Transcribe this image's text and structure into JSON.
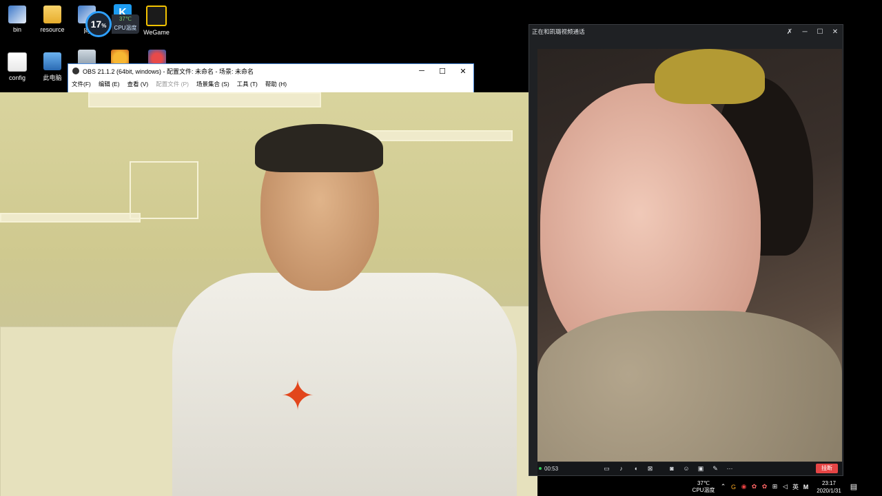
{
  "desktop_icons": [
    {
      "label": "bin"
    },
    {
      "label": "resource"
    },
    {
      "label": "网"
    },
    {
      "label": "WeGame"
    },
    {
      "label": "config"
    },
    {
      "label": "此电脑"
    }
  ],
  "cpu_widget": {
    "percent": "17",
    "unit": "%",
    "temp": "37℃",
    "label": "CPU温度"
  },
  "obs": {
    "title": "OBS 21.1.2 (64bit, windows) - 配置文件: 未命名 - 场景: 未命名",
    "menu": [
      "文件(F)",
      "编辑 (E)",
      "查看 (V)",
      "配置文件 (P)",
      "场景集合 (S)",
      "工具 (T)",
      "帮助 (H)"
    ],
    "minimize": "─",
    "maximize": "☐",
    "close": "✕"
  },
  "call": {
    "title": "正在和凯璐视频通话",
    "pin": "✗",
    "minimize": "─",
    "maximize": "☐",
    "close": "✕",
    "elapsed": "00:53",
    "hangup_label": "挂断"
  },
  "tray": {
    "temp": "37℃",
    "temp_label": "CPU温度",
    "ime": "英",
    "time": "23:17",
    "date": "2020/1/31"
  }
}
